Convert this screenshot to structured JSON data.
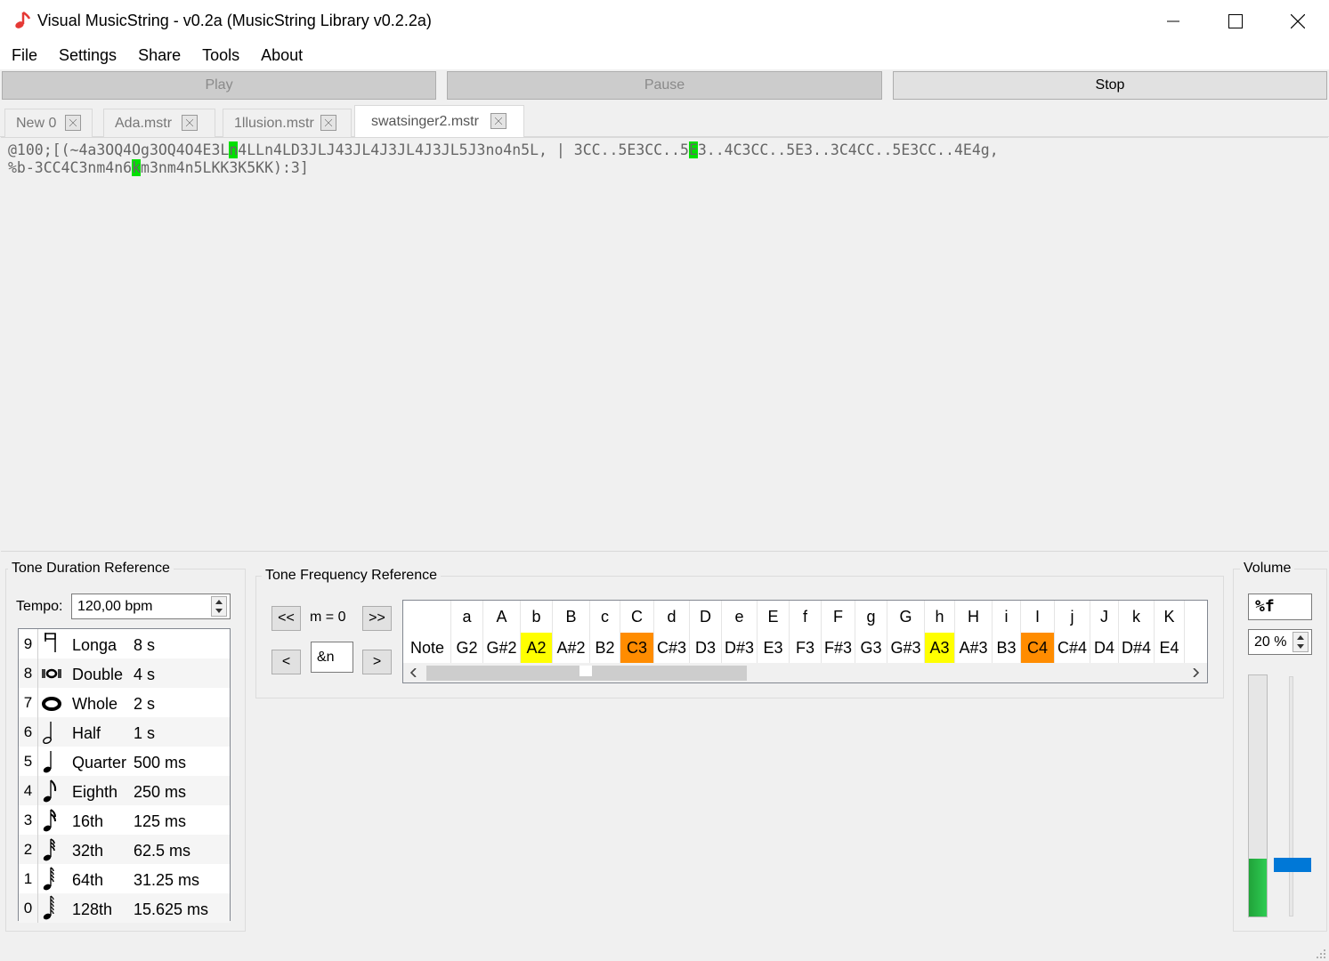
{
  "window": {
    "title": "Visual MusicString - v0.2a (MusicString Library v0.2.2a)"
  },
  "menu": [
    "File",
    "Settings",
    "Share",
    "Tools",
    "About"
  ],
  "controls": {
    "play": "Play",
    "pause": "Pause",
    "stop": "Stop"
  },
  "tabs": [
    {
      "label": "New 0"
    },
    {
      "label": "Ada.mstr"
    },
    {
      "label": "1llusion.mstr"
    },
    {
      "label": "swatsinger2.mstr",
      "active": true
    }
  ],
  "editor": {
    "line1_a": "@100;[(~4a3OQ4Og3OQ4O4E3L",
    "line1_hl1": "n",
    "line1_b": "4LLn4LD3JLJ43JL4J3JL4J3JL5J3no4n5L, | 3CC..5E3CC..5",
    "line1_hl2": "E",
    "line1_c": "3..4C3CC..5E3..3C4CC..5E3CC..4E4g,",
    "line2_a": "%b-3CC4C3nm4n6",
    "line2_hl": "k",
    "line2_b": "m3nm4n5LKK3K5KK):3]"
  },
  "duration_ref": {
    "title": "Tone Duration Reference",
    "tempo_label": "Tempo:",
    "tempo_value": "120,00 bpm",
    "rows": [
      {
        "num": "9",
        "icon": "longa-note-icon",
        "name": "Longa",
        "value": "8 s"
      },
      {
        "num": "8",
        "icon": "double-whole-note-icon",
        "name": "Double",
        "value": "4 s"
      },
      {
        "num": "7",
        "icon": "whole-note-icon",
        "name": "Whole",
        "value": "2 s"
      },
      {
        "num": "6",
        "icon": "half-note-icon",
        "name": "Half",
        "value": "1 s"
      },
      {
        "num": "5",
        "icon": "quarter-note-icon",
        "name": "Quarter",
        "value": "500 ms"
      },
      {
        "num": "4",
        "icon": "eighth-note-icon",
        "name": "Eighth",
        "value": "250 ms"
      },
      {
        "num": "3",
        "icon": "sixteenth-note-icon",
        "name": "16th",
        "value": "125 ms"
      },
      {
        "num": "2",
        "icon": "thirty-second-note-icon",
        "name": "32th",
        "value": "62.5 ms"
      },
      {
        "num": "1",
        "icon": "sixty-fourth-note-icon",
        "name": "64th",
        "value": "31.25 ms"
      },
      {
        "num": "0",
        "icon": "hundred-twenty-eighth-note-icon",
        "name": "128th",
        "value": "15.625 ms"
      }
    ]
  },
  "frequency_ref": {
    "title": "Tone Frequency Reference",
    "prev_octave": "<<",
    "next_octave": ">>",
    "prev": "<",
    "next": ">",
    "m_label": "m = 0",
    "note_value": "&n",
    "header": "Note",
    "notes": [
      {
        "key": "a",
        "name": "G2"
      },
      {
        "key": "A",
        "name": "G#2"
      },
      {
        "key": "b",
        "name": "A2",
        "highlight": "#ffff00"
      },
      {
        "key": "B",
        "name": "A#2"
      },
      {
        "key": "c",
        "name": "B2"
      },
      {
        "key": "C",
        "name": "C3",
        "highlight": "#ff8c00"
      },
      {
        "key": "d",
        "name": "C#3"
      },
      {
        "key": "D",
        "name": "D3"
      },
      {
        "key": "e",
        "name": "D#3"
      },
      {
        "key": "E",
        "name": "E3"
      },
      {
        "key": "f",
        "name": "F3"
      },
      {
        "key": "F",
        "name": "F#3"
      },
      {
        "key": "g",
        "name": "G3"
      },
      {
        "key": "G",
        "name": "G#3"
      },
      {
        "key": "h",
        "name": "A3",
        "highlight": "#ffff00"
      },
      {
        "key": "H",
        "name": "A#3"
      },
      {
        "key": "i",
        "name": "B3"
      },
      {
        "key": "I",
        "name": "C4",
        "highlight": "#ff8c00"
      },
      {
        "key": "j",
        "name": "C#4"
      },
      {
        "key": "J",
        "name": "D4"
      },
      {
        "key": "k",
        "name": "D#4"
      },
      {
        "key": "K",
        "name": "E4"
      }
    ]
  },
  "volume": {
    "title": "Volume",
    "value_code": "%f",
    "percent": "20 %",
    "level_fraction": 0.24,
    "slider_fraction": 0.22
  }
}
